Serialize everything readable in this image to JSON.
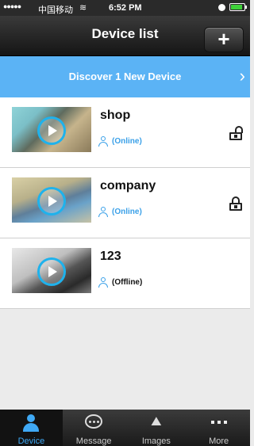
{
  "status_bar": {
    "signal": "●●●●●",
    "carrier": "中国移动",
    "wifi": "≋",
    "time": "6:52 PM"
  },
  "nav": {
    "title": "Device list",
    "add_label": "+"
  },
  "discover": {
    "text": "Discover 1 New Device",
    "chevron": "›"
  },
  "devices": [
    {
      "name": "shop",
      "status": "(Online)",
      "lock": "unlocked",
      "status_color": "#3aa0e8"
    },
    {
      "name": "company",
      "status": "(Online)",
      "lock": "locked",
      "status_color": "#3aa0e8"
    },
    {
      "name": "123",
      "status": "(Offline)",
      "lock": "none",
      "status_color": "#111111"
    }
  ],
  "tabs": [
    {
      "label": "Device",
      "icon": "person-icon",
      "active": true
    },
    {
      "label": "Message",
      "icon": "message-icon",
      "active": false
    },
    {
      "label": "Images",
      "icon": "images-icon",
      "active": false
    },
    {
      "label": "More",
      "icon": "more-icon",
      "active": false
    }
  ],
  "colors": {
    "accent": "#5bb3f5",
    "tab_active": "#3fa9f5"
  }
}
